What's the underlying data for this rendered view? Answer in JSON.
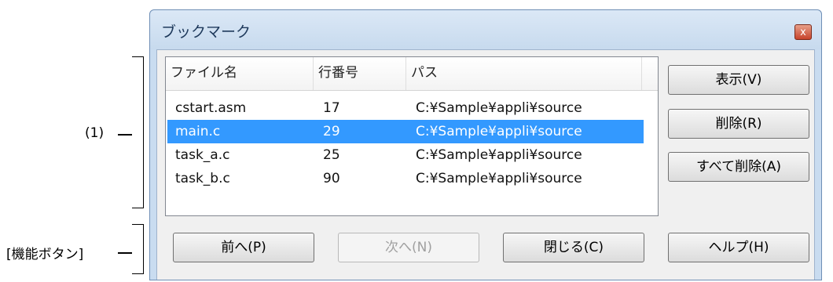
{
  "annotations": {
    "list_label": "(1)",
    "buttons_label": "[機能ボタン]"
  },
  "window": {
    "title": "ブックマーク",
    "close_glyph": "x"
  },
  "list": {
    "columns": [
      "ファイル名",
      "行番号",
      "パス"
    ],
    "rows": [
      {
        "file": "cstart.asm",
        "line": "17",
        "path": "C:¥Sample¥appli¥source",
        "selected": false
      },
      {
        "file": "main.c",
        "line": "29",
        "path": "C:¥Sample¥appli¥source",
        "selected": true
      },
      {
        "file": "task_a.c",
        "line": "25",
        "path": "C:¥Sample¥appli¥source",
        "selected": false
      },
      {
        "file": "task_b.c",
        "line": "90",
        "path": "C:¥Sample¥appli¥source",
        "selected": false
      }
    ]
  },
  "side_buttons": {
    "show": "表示(V)",
    "delete": "削除(R)",
    "delete_all": "すべて削除(A)"
  },
  "bottom_buttons": {
    "prev": "前へ(P)",
    "next": "次へ(N)",
    "close": "閉じる(C)",
    "help": "ヘルプ(H)"
  }
}
